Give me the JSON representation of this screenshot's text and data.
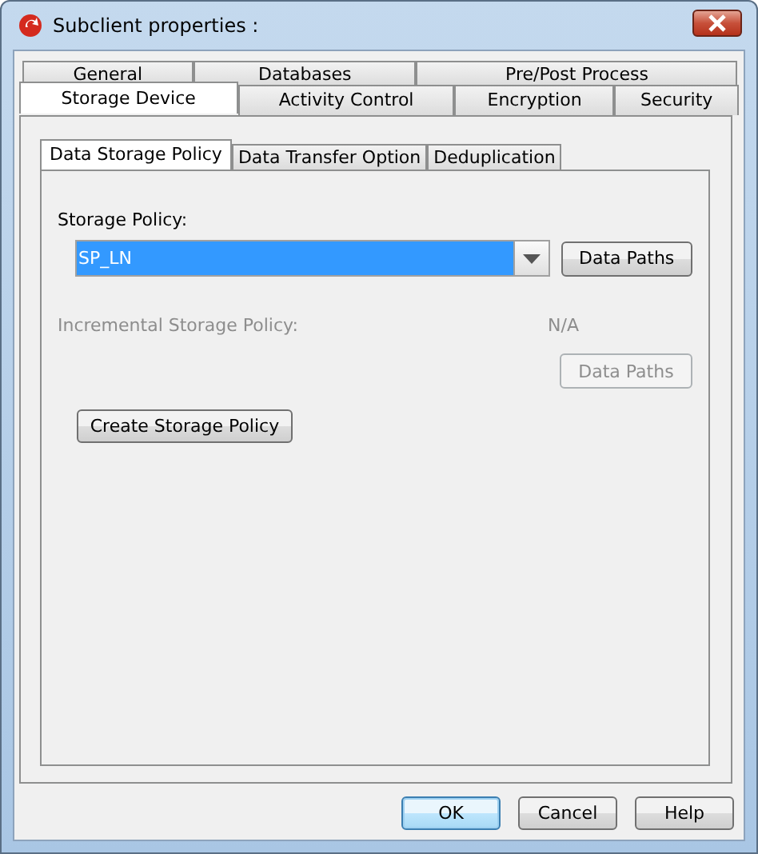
{
  "window": {
    "title": "Subclient properties :"
  },
  "tab_rows": [
    [
      {
        "label": "General",
        "selected": false
      },
      {
        "label": "Databases",
        "selected": false
      },
      {
        "label": "Pre/Post Process",
        "selected": false
      }
    ],
    [
      {
        "label": "Storage Device",
        "selected": true
      },
      {
        "label": "Activity Control",
        "selected": false
      },
      {
        "label": "Encryption",
        "selected": false
      },
      {
        "label": "Security",
        "selected": false
      }
    ]
  ],
  "sub_tabs": [
    {
      "label": "Data Storage Policy",
      "selected": true
    },
    {
      "label": "Data Transfer Option",
      "selected": false
    },
    {
      "label": "Deduplication",
      "selected": false
    }
  ],
  "storage_policy": {
    "label": "Storage Policy:",
    "value": "SP_LN",
    "button": {
      "label": "Data Paths",
      "disabled": false
    }
  },
  "incremental_policy": {
    "label": "Incremental Storage Policy:",
    "value": "N/A",
    "disabled": true,
    "button": {
      "label": "Data Paths",
      "disabled": true
    }
  },
  "create_button": {
    "label": "Create Storage Policy"
  },
  "buttons": [
    {
      "label": "OK",
      "default": true
    },
    {
      "label": "Cancel",
      "default": false
    },
    {
      "label": "Help",
      "default": false
    }
  ]
}
